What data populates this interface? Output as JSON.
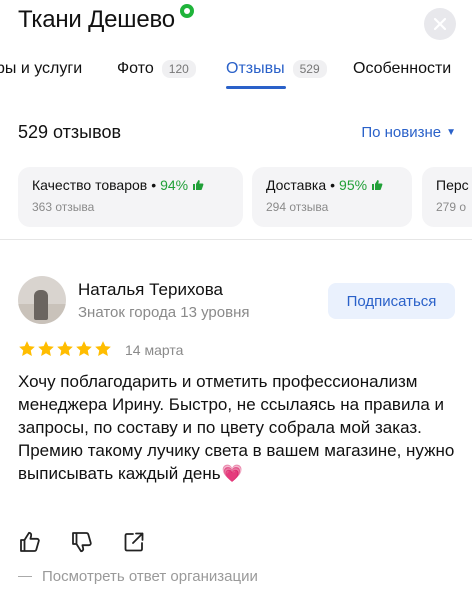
{
  "header": {
    "title": "Ткани Дешево",
    "close_icon": "close-icon"
  },
  "tabs": [
    {
      "label": "ры и услуги",
      "count": ""
    },
    {
      "label": "Фото",
      "count": "120"
    },
    {
      "label": "Отзывы",
      "count": "529",
      "active": true
    },
    {
      "label": "Особенности",
      "count": ""
    }
  ],
  "reviews_header": {
    "count_label": "529 отзывов",
    "sort_label": "По новизне",
    "sort_icon": "triangle-down-icon"
  },
  "categories": [
    {
      "name": "Качество товаров",
      "sep": "•",
      "percent": "94%",
      "count": "363 отзыва"
    },
    {
      "name": "Доставка",
      "sep": "•",
      "percent": "95%",
      "count": "294 отзыва"
    },
    {
      "name": "Перс",
      "sep": "",
      "percent": "",
      "count": "279 о"
    }
  ],
  "colors": {
    "accent": "#2a61c9",
    "positive": "#21a038",
    "star": "#ffbd00",
    "muted": "#8a8a8a"
  },
  "review": {
    "author": "Наталья Терихова",
    "author_level": "Знаток города 13 уровня",
    "subscribe_label": "Подписаться",
    "rating": 5,
    "date": "14 марта",
    "text": "Хочу поблагодарить и отметить профессионализм менеджера Ирину. Быстро, не ссылаясь на правила и запросы, по составу и по цвету собрала мой заказ. Премию такому лучику света в вашем магазине, нужно выписывать каждый день",
    "emoji": "💗",
    "actions": [
      "thumbs-up-icon",
      "thumbs-down-icon",
      "share-icon"
    ],
    "org_reply_label": "Посмотреть ответ организации"
  }
}
